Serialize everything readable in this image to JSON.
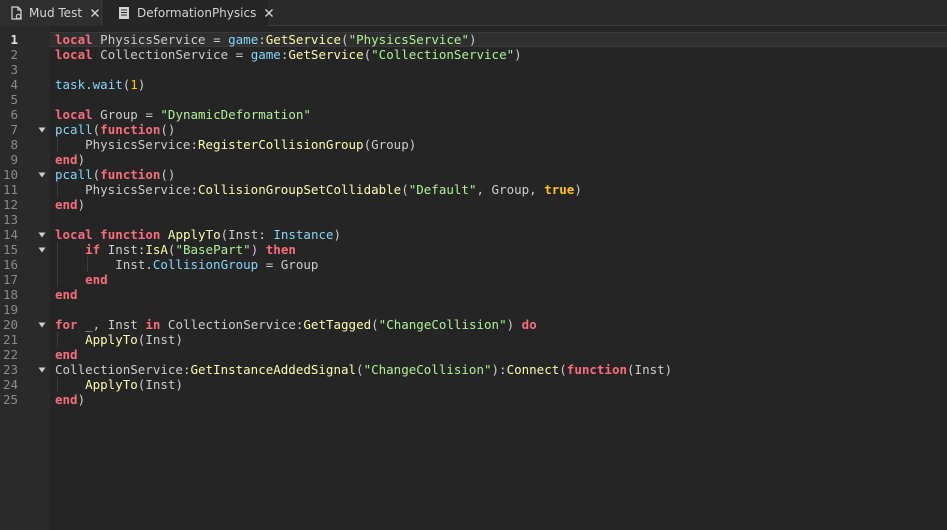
{
  "tabs": [
    {
      "label": "Mud Test",
      "icon": "script-icon",
      "active": false
    },
    {
      "label": "DeformationPhysics",
      "icon": "document-icon",
      "active": true
    }
  ],
  "editor": {
    "current_line": 1,
    "fold_lines": [
      7,
      10,
      14,
      15,
      20,
      23
    ],
    "lines": [
      [
        [
          "kw",
          "local"
        ],
        [
          "id",
          " PhysicsService "
        ],
        [
          "op",
          "= "
        ],
        [
          "bi",
          "game"
        ],
        [
          "op",
          ":"
        ],
        [
          "fn",
          "GetService"
        ],
        [
          "op",
          "("
        ],
        [
          "str",
          "\"PhysicsService\""
        ],
        [
          "op",
          ")"
        ]
      ],
      [
        [
          "kw",
          "local"
        ],
        [
          "id",
          " CollectionService "
        ],
        [
          "op",
          "= "
        ],
        [
          "bi",
          "game"
        ],
        [
          "op",
          ":"
        ],
        [
          "fn",
          "GetService"
        ],
        [
          "op",
          "("
        ],
        [
          "str",
          "\"CollectionService\""
        ],
        [
          "op",
          ")"
        ]
      ],
      [],
      [
        [
          "bi",
          "task"
        ],
        [
          "op",
          "."
        ],
        [
          "bi",
          "wait"
        ],
        [
          "op",
          "("
        ],
        [
          "num",
          "1"
        ],
        [
          "op",
          ")"
        ]
      ],
      [],
      [
        [
          "kw",
          "local"
        ],
        [
          "id",
          " Group "
        ],
        [
          "op",
          "= "
        ],
        [
          "str",
          "\"DynamicDeformation\""
        ]
      ],
      [
        [
          "bi",
          "pcall"
        ],
        [
          "op",
          "("
        ],
        [
          "kw",
          "function"
        ],
        [
          "op",
          "()"
        ]
      ],
      [
        [
          "id",
          "    PhysicsService"
        ],
        [
          "op",
          ":"
        ],
        [
          "fn",
          "RegisterCollisionGroup"
        ],
        [
          "op",
          "("
        ],
        [
          "id",
          "Group"
        ],
        [
          "op",
          ")"
        ]
      ],
      [
        [
          "kw",
          "end"
        ],
        [
          "op",
          ")"
        ]
      ],
      [
        [
          "bi",
          "pcall"
        ],
        [
          "op",
          "("
        ],
        [
          "kw",
          "function"
        ],
        [
          "op",
          "()"
        ]
      ],
      [
        [
          "id",
          "    PhysicsService"
        ],
        [
          "op",
          ":"
        ],
        [
          "fn",
          "CollisionGroupSetCollidable"
        ],
        [
          "op",
          "("
        ],
        [
          "str",
          "\"Default\""
        ],
        [
          "op",
          ", "
        ],
        [
          "id",
          "Group"
        ],
        [
          "op",
          ", "
        ],
        [
          "bool",
          "true"
        ],
        [
          "op",
          ")"
        ]
      ],
      [
        [
          "kw",
          "end"
        ],
        [
          "op",
          ")"
        ]
      ],
      [],
      [
        [
          "kw",
          "local"
        ],
        [
          "id",
          " "
        ],
        [
          "kw",
          "function"
        ],
        [
          "id",
          " "
        ],
        [
          "fn",
          "ApplyTo"
        ],
        [
          "op",
          "("
        ],
        [
          "id",
          "Inst"
        ],
        [
          "op",
          ": "
        ],
        [
          "bi",
          "Instance"
        ],
        [
          "op",
          ")"
        ]
      ],
      [
        [
          "id",
          "    "
        ],
        [
          "kw",
          "if"
        ],
        [
          "id",
          " Inst"
        ],
        [
          "op",
          ":"
        ],
        [
          "fn",
          "IsA"
        ],
        [
          "op",
          "("
        ],
        [
          "str",
          "\"BasePart\""
        ],
        [
          "op",
          ") "
        ],
        [
          "kw",
          "then"
        ]
      ],
      [
        [
          "id",
          "        Inst"
        ],
        [
          "op",
          "."
        ],
        [
          "bi",
          "CollisionGroup"
        ],
        [
          "op",
          " = "
        ],
        [
          "id",
          "Group"
        ]
      ],
      [
        [
          "id",
          "    "
        ],
        [
          "kw",
          "end"
        ]
      ],
      [
        [
          "kw",
          "end"
        ]
      ],
      [],
      [
        [
          "kw",
          "for"
        ],
        [
          "id",
          " _"
        ],
        [
          "op",
          ", "
        ],
        [
          "id",
          "Inst "
        ],
        [
          "kw",
          "in"
        ],
        [
          "id",
          " CollectionService"
        ],
        [
          "op",
          ":"
        ],
        [
          "fn",
          "GetTagged"
        ],
        [
          "op",
          "("
        ],
        [
          "str",
          "\"ChangeCollision\""
        ],
        [
          "op",
          ") "
        ],
        [
          "kw",
          "do"
        ]
      ],
      [
        [
          "id",
          "    "
        ],
        [
          "fn",
          "ApplyTo"
        ],
        [
          "op",
          "("
        ],
        [
          "id",
          "Inst"
        ],
        [
          "op",
          ")"
        ]
      ],
      [
        [
          "kw",
          "end"
        ]
      ],
      [
        [
          "id",
          "CollectionService"
        ],
        [
          "op",
          ":"
        ],
        [
          "fn",
          "GetInstanceAddedSignal"
        ],
        [
          "op",
          "("
        ],
        [
          "str",
          "\"ChangeCollision\""
        ],
        [
          "op",
          "):"
        ],
        [
          "fn",
          "Connect"
        ],
        [
          "op",
          "("
        ],
        [
          "kw",
          "function"
        ],
        [
          "op",
          "("
        ],
        [
          "id",
          "Inst"
        ],
        [
          "op",
          ")"
        ]
      ],
      [
        [
          "id",
          "    "
        ],
        [
          "fn",
          "ApplyTo"
        ],
        [
          "op",
          "("
        ],
        [
          "id",
          "Inst"
        ],
        [
          "op",
          ")"
        ]
      ],
      [
        [
          "kw",
          "end"
        ],
        [
          "op",
          ")"
        ]
      ]
    ]
  }
}
